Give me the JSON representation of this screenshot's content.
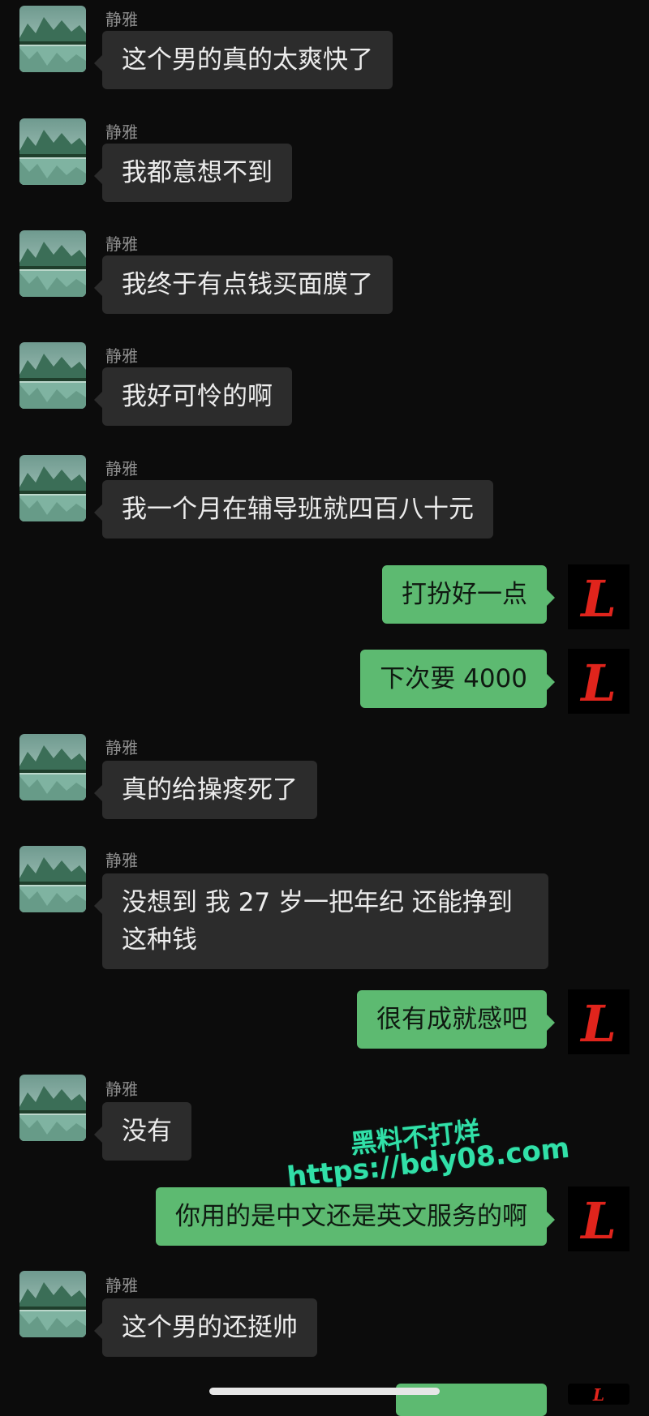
{
  "contact": {
    "name": "静雅"
  },
  "messages": [
    {
      "side": "left",
      "text": "这个男的真的太爽快了"
    },
    {
      "side": "left",
      "text": "我都意想不到"
    },
    {
      "side": "left",
      "text": "我终于有点钱买面膜了"
    },
    {
      "side": "left",
      "text": "我好可怜的啊"
    },
    {
      "side": "left",
      "text": "我一个月在辅导班就四百八十元"
    },
    {
      "side": "right",
      "text": "打扮好一点"
    },
    {
      "side": "right",
      "text": "下次要 4000"
    },
    {
      "side": "left",
      "text": "真的给操疼死了"
    },
    {
      "side": "left",
      "text": "没想到 我 27 岁一把年纪 还能挣到这种钱"
    },
    {
      "side": "right",
      "text": "很有成就感吧"
    },
    {
      "side": "left",
      "text": "没有"
    },
    {
      "side": "right",
      "text": "你用的是中文还是英文服务的啊"
    },
    {
      "side": "left",
      "text": "这个男的还挺帅"
    }
  ],
  "watermark": {
    "line1": "黑料不打烊",
    "line2": "https://bdy08.com"
  },
  "colors": {
    "background": "#0c0c0c",
    "incoming_bubble": "#2c2c2c",
    "outgoing_bubble": "#5dba71",
    "watermark": "#31e0a8",
    "self_avatar_letter": "#e0241c"
  },
  "icons": {
    "contact_avatar": "landscape-photo",
    "self_avatar": "red-gothic-letter-L"
  }
}
